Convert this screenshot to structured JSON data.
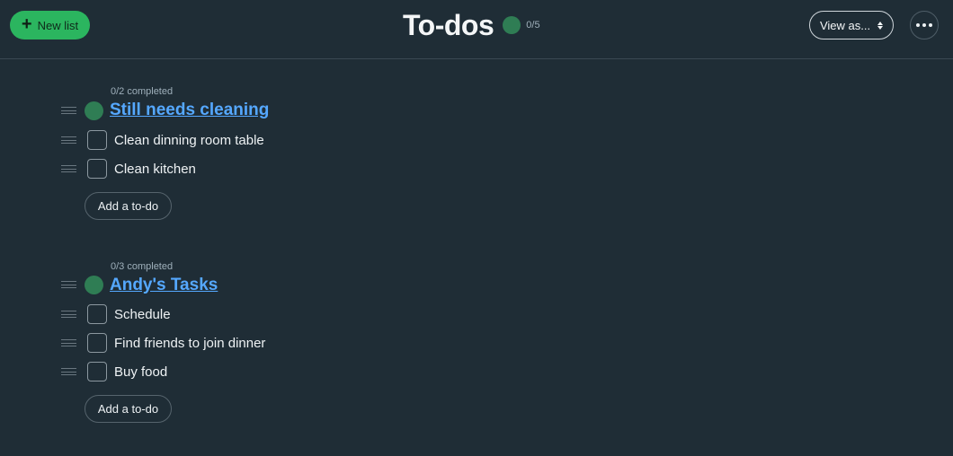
{
  "header": {
    "new_list_label": "New list",
    "title": "To-dos",
    "count": "0/5",
    "view_as_label": "View as..."
  },
  "lists": [
    {
      "completed": "0/2 completed",
      "title": "Still needs cleaning",
      "items": [
        {
          "label": "Clean dinning room table",
          "checked": false
        },
        {
          "label": "Clean kitchen",
          "checked": false
        }
      ],
      "add_label": "Add a to-do"
    },
    {
      "completed": "0/3 completed",
      "title": "Andy's Tasks",
      "items": [
        {
          "label": "Schedule",
          "checked": false
        },
        {
          "label": "Find friends to join dinner",
          "checked": false
        },
        {
          "label": "Buy food",
          "checked": false
        }
      ],
      "add_label": "Add a to-do"
    }
  ],
  "colors": {
    "background": "#1f2d36",
    "accent_green": "#2bb55f",
    "status_dot": "#2f7d54",
    "link_blue": "#55a8ff"
  },
  "icons": [
    "plus-icon",
    "chevron-updown-icon",
    "more-icon",
    "drag-handle-icon",
    "checkbox"
  ]
}
